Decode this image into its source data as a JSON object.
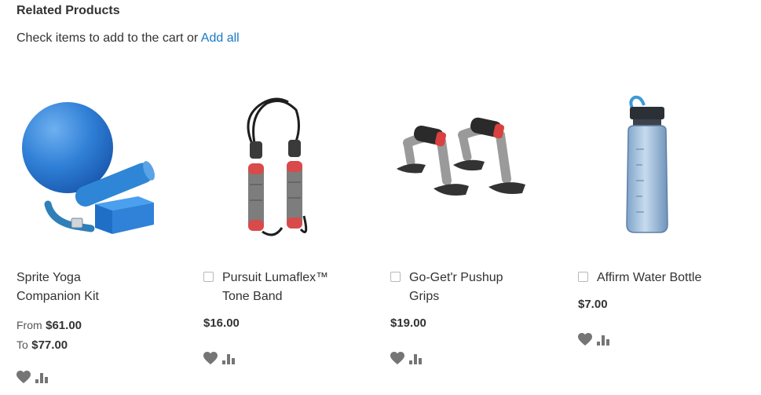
{
  "section": {
    "title": "Related Products",
    "intro_text": "Check items to add to the cart or",
    "add_all_label": "Add all"
  },
  "products": [
    {
      "name_line1": "Sprite Yoga",
      "name_line2": "Companion Kit",
      "has_checkbox": false,
      "price_from_label": "From",
      "price_from": "$61.00",
      "price_to_label": "To",
      "price_to": "$77.00",
      "image": "yoga-kit-image"
    },
    {
      "name_line1": "Pursuit Lumaflex™",
      "name_line2": "Tone Band",
      "has_checkbox": true,
      "price": "$16.00",
      "image": "tone-band-image"
    },
    {
      "name_line1": "Go-Get'r Pushup",
      "name_line2": "Grips",
      "has_checkbox": true,
      "price": "$19.00",
      "image": "pushup-grips-image"
    },
    {
      "name_line1": "Affirm Water Bottle",
      "has_checkbox": true,
      "price": "$7.00",
      "image": "water-bottle-image"
    }
  ],
  "icons": {
    "wishlist": "heart-icon",
    "compare": "compare-bars-icon",
    "action_color": "#757575"
  },
  "colors": {
    "link": "#1979c3",
    "text": "#333333"
  }
}
